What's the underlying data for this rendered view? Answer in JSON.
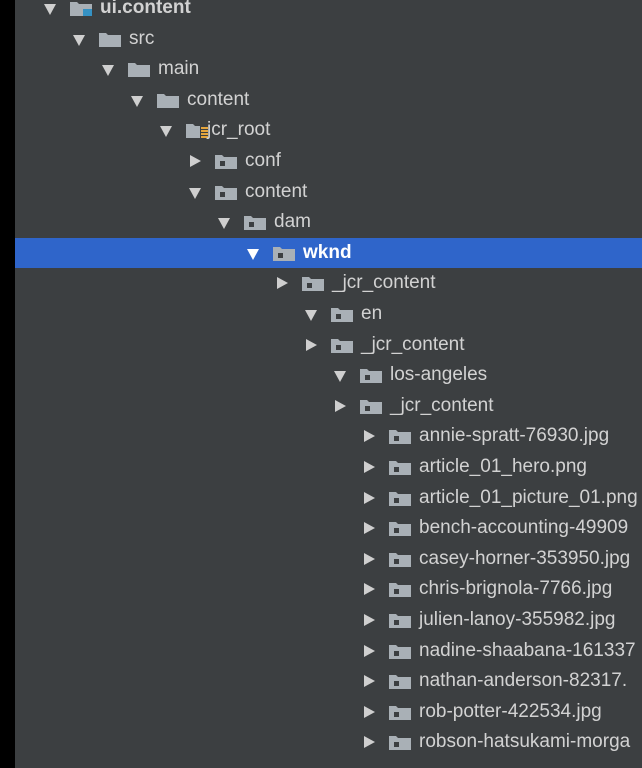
{
  "tree": {
    "rows": [
      {
        "label": "ui.content",
        "icon": "module-folder-icon",
        "expanded": true,
        "bold": true
      },
      {
        "label": "src",
        "icon": "folder-icon",
        "expanded": true
      },
      {
        "label": "main",
        "icon": "folder-icon",
        "expanded": true
      },
      {
        "label": "content",
        "icon": "folder-icon",
        "expanded": true
      },
      {
        "label": "jcr_root",
        "icon": "resource-root-folder-icon",
        "expanded": true
      },
      {
        "label": "conf",
        "icon": "package-folder-icon",
        "expanded": false
      },
      {
        "label": "content",
        "icon": "package-folder-icon",
        "expanded": true
      },
      {
        "label": "dam",
        "icon": "package-folder-icon",
        "expanded": true
      },
      {
        "label": "wknd",
        "icon": "package-folder-icon",
        "expanded": true,
        "selected": true
      },
      {
        "label": "_jcr_content",
        "icon": "package-folder-icon",
        "expanded": false
      },
      {
        "label": "en",
        "icon": "package-folder-icon",
        "expanded": true
      },
      {
        "label": "_jcr_content",
        "icon": "package-folder-icon",
        "expanded": false
      },
      {
        "label": "los-angeles",
        "icon": "package-folder-icon",
        "expanded": true
      },
      {
        "label": "_jcr_content",
        "icon": "package-folder-icon",
        "expanded": false
      },
      {
        "label": "annie-spratt-76930.jpg",
        "icon": "package-folder-icon",
        "expanded": false
      },
      {
        "label": "article_01_hero.png",
        "icon": "package-folder-icon",
        "expanded": false
      },
      {
        "label": "article_01_picture_01.png",
        "icon": "package-folder-icon",
        "expanded": false
      },
      {
        "label": "bench-accounting-49909",
        "icon": "package-folder-icon",
        "expanded": false
      },
      {
        "label": "casey-horner-353950.jpg",
        "icon": "package-folder-icon",
        "expanded": false
      },
      {
        "label": "chris-brignola-7766.jpg",
        "icon": "package-folder-icon",
        "expanded": false
      },
      {
        "label": "julien-lanoy-355982.jpg",
        "icon": "package-folder-icon",
        "expanded": false
      },
      {
        "label": "nadine-shaabana-161337",
        "icon": "package-folder-icon",
        "expanded": false
      },
      {
        "label": "nathan-anderson-82317.",
        "icon": "package-folder-icon",
        "expanded": false
      },
      {
        "label": "rob-potter-422534.jpg",
        "icon": "package-folder-icon",
        "expanded": false
      },
      {
        "label": "robson-hatsukami-morga",
        "icon": "package-folder-icon",
        "expanded": false
      }
    ]
  },
  "colors": {
    "panel": "#3c3f41",
    "selection": "#2f65ca",
    "text": "#d2d2d2",
    "folder": "#a9b0b6",
    "package_dot": "#3c3f41",
    "resource_marker": "#e5a53c",
    "module_marker": "#3592c4"
  }
}
